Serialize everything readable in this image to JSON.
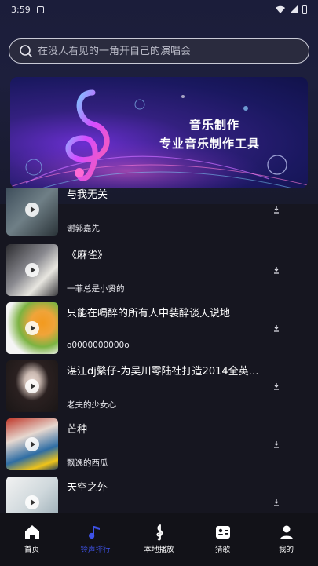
{
  "status_bar": {
    "time": "3:59"
  },
  "search": {
    "placeholder": "在没人看见的一角开自己的演唱会"
  },
  "banner": {
    "line1": "音乐制作",
    "line2": "专业音乐制作工具"
  },
  "songs": [
    {
      "title": "与我无关",
      "artist": "谢郭嘉先"
    },
    {
      "title": "《麻雀》",
      "artist": "一菲总是小贤的"
    },
    {
      "title": "只能在喝醉的所有人中装醉谈天说地",
      "artist": "o0000000000o"
    },
    {
      "title": "湛江dj繁仔-为吴川零陆社打造2014全英文...",
      "artist": "老夫的少女心"
    },
    {
      "title": "芒种",
      "artist": "飘逸的西瓜"
    },
    {
      "title": "天空之外",
      "artist": ""
    }
  ],
  "nav": {
    "items": [
      {
        "label": "首页",
        "icon": "home-icon"
      },
      {
        "label": "铃声排行",
        "icon": "music-note-icon"
      },
      {
        "label": "本地播放",
        "icon": "treble-clef-icon"
      },
      {
        "label": "猜歌",
        "icon": "quiz-card-icon"
      },
      {
        "label": "我的",
        "icon": "person-icon"
      }
    ],
    "active_index": 1
  },
  "colors": {
    "accent": "#3e52e6",
    "background": "#161620",
    "nav_background": "#121218"
  }
}
